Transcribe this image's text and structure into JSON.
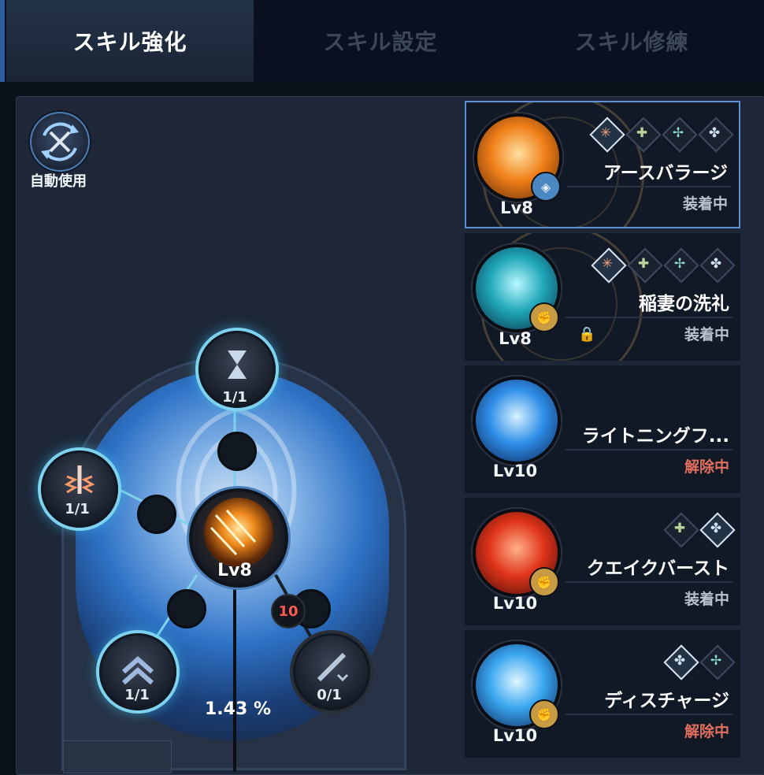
{
  "tabs": [
    {
      "label": "スキル強化",
      "active": true
    },
    {
      "label": "スキル設定",
      "active": false
    },
    {
      "label": "スキル修練",
      "active": false
    }
  ],
  "auto_use": {
    "label": "自動使用",
    "icon": "crossed-swords-refresh-icon"
  },
  "tree": {
    "main_level": "Lv8",
    "top_node": "1/1",
    "left_node": "1/1",
    "bottom_left_node": "1/1",
    "bottom_right_node": "0/1",
    "badge": "10",
    "percent": "1.43 %"
  },
  "colors": {
    "accent": "#5e8fd0",
    "glow": "#7fd2ee",
    "equipped": "#b9c3d0",
    "released": "#e06f5e"
  },
  "skills": [
    {
      "name": "アースバラージ",
      "level": "Lv8",
      "status": "装着中",
      "icon": "earth-barrage-icon",
      "theme": "fire",
      "badge": "shield-icon",
      "selected": true,
      "locked": false,
      "minis": [
        "spark-icon",
        "dagger-icon",
        "arrows-icon",
        "flower-icon"
      ]
    },
    {
      "name": "稲妻の洗礼",
      "level": "Lv8",
      "status": "装着中",
      "icon": "lightning-baptism-icon",
      "theme": "teal",
      "badge": "fist-icon",
      "selected": false,
      "locked": true,
      "minis": [
        "spark-icon",
        "dagger-icon",
        "arrows-icon",
        "flower-icon"
      ]
    },
    {
      "name": "ライトニングフ...",
      "level": "Lv10",
      "status": "解除中",
      "icon": "lightning-icon",
      "theme": "blue",
      "badge": "",
      "selected": false,
      "locked": false,
      "minis": []
    },
    {
      "name": "クエイクバースト",
      "level": "Lv10",
      "status": "装着中",
      "icon": "quake-burst-icon",
      "theme": "red",
      "badge": "fist-icon",
      "selected": false,
      "locked": false,
      "minis": [
        "dagger-icon",
        "flower-icon"
      ]
    },
    {
      "name": "ディスチャージ",
      "level": "Lv10",
      "status": "解除中",
      "icon": "discharge-icon",
      "theme": "blue",
      "badge": "fist-icon",
      "selected": false,
      "locked": false,
      "minis": [
        "flower-icon",
        "arrows-icon"
      ]
    }
  ]
}
